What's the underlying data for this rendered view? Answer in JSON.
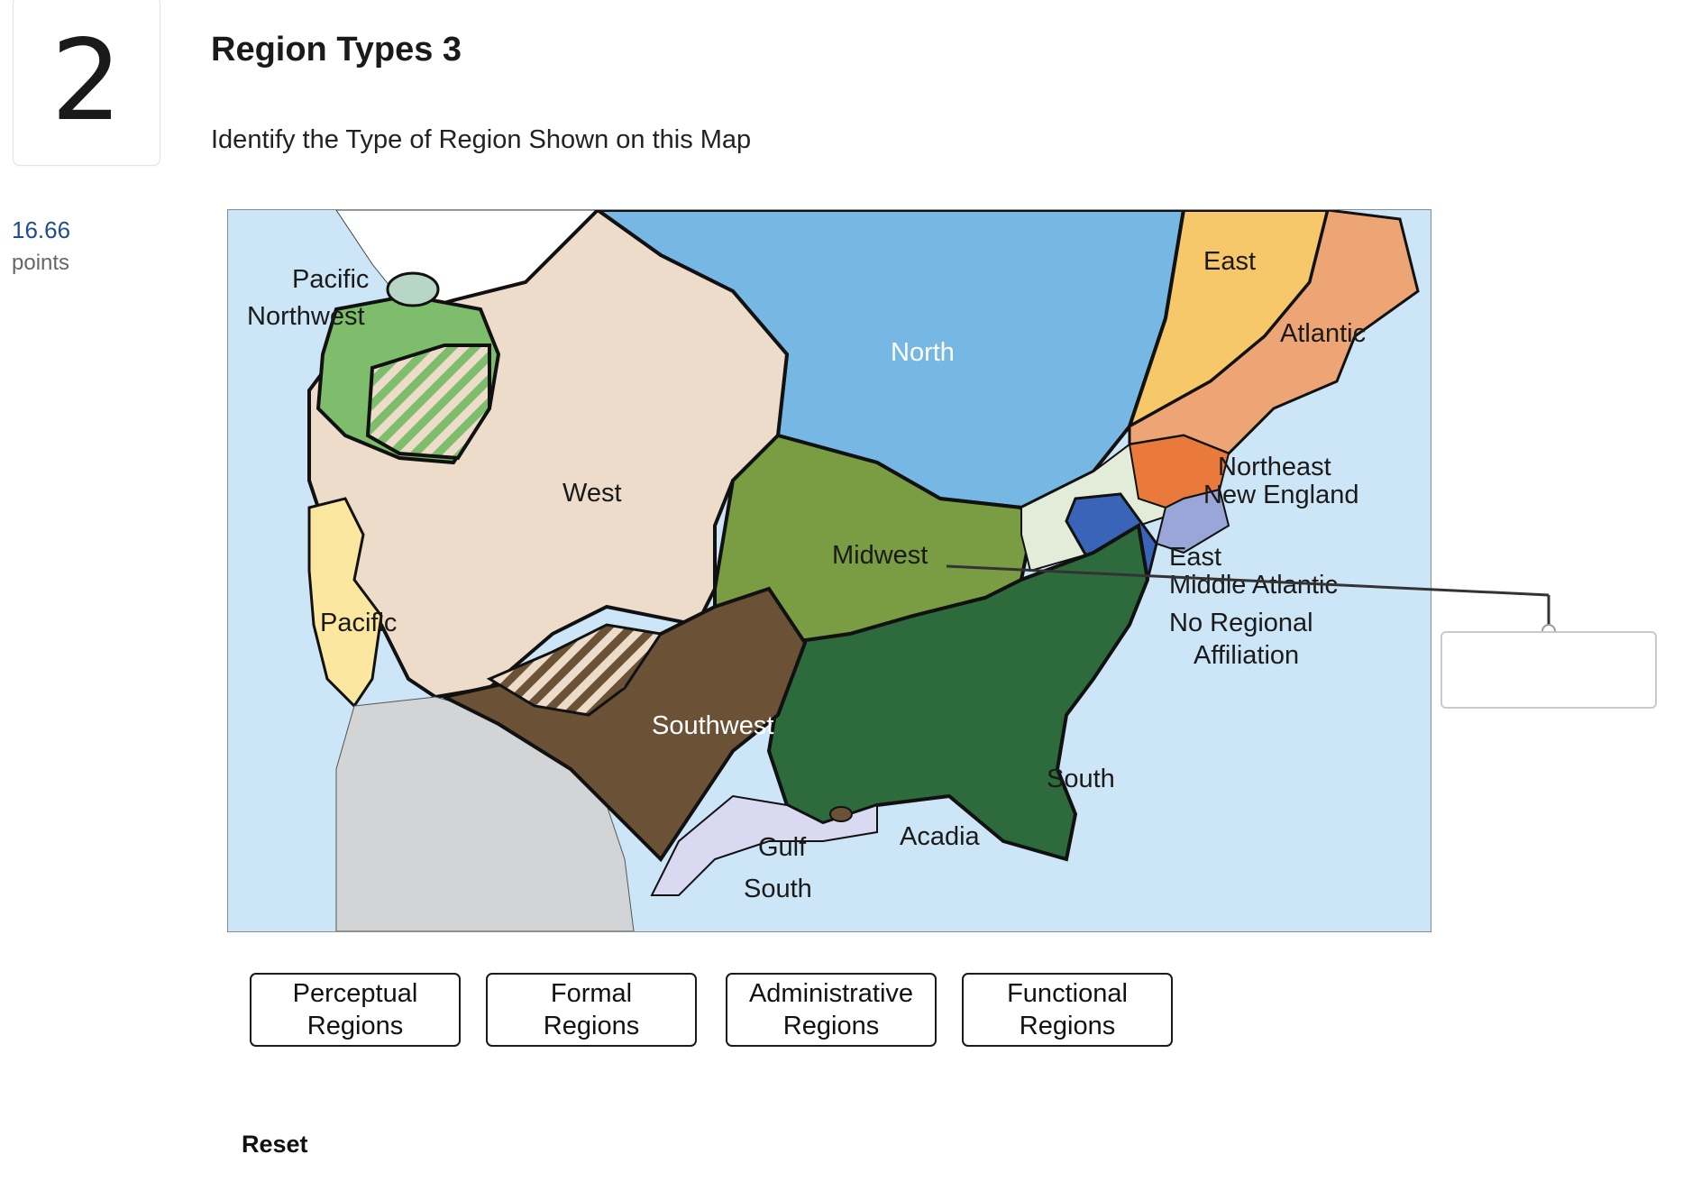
{
  "question": {
    "number": "2",
    "points_value": "16.66",
    "points_label": "points",
    "title": "Region Types 3",
    "prompt": "Identify the Type of Region Shown on this Map"
  },
  "map": {
    "labels": {
      "pacific_nw_1": "Pacific",
      "pacific_nw_2": "Northwest",
      "pacific": "Pacific",
      "west": "West",
      "north": "North",
      "east": "East",
      "atlantic": "Atlantic",
      "northeast": "Northeast",
      "new_england": "New England",
      "east_ma_1": "East",
      "east_ma_2": "Middle Atlantic",
      "no_regional_1": "No Regional",
      "no_regional_2": "Affiliation",
      "midwest": "Midwest",
      "southwest": "Southwest",
      "south": "South",
      "acadia": "Acadia",
      "gulf_1": "Gulf",
      "gulf_2": "South"
    },
    "colors": {
      "ocean": "#cde6f7",
      "west": "#ecdcc9",
      "north": "#76b7e4",
      "east": "#f7c86a",
      "atlantic": "#eea576",
      "new_england": "#9aa6d8",
      "northeast": "#ea7a3c",
      "middle_atlantic": "#3a64b7",
      "no_affiliation": "#e3ecd9",
      "midwest": "#7a9c43",
      "south": "#2d6a3c",
      "southwest": "#6b5236",
      "pacific": "#fbe7a0",
      "pacific_nw": "#7dbd6c",
      "gulf": "#d9d9f1",
      "mexico": "#d3d4d6"
    }
  },
  "choices": [
    {
      "id": "perceptual",
      "label_1": "Perceptual",
      "label_2": "Regions"
    },
    {
      "id": "formal",
      "label_1": "Formal",
      "label_2": "Regions"
    },
    {
      "id": "administrative",
      "label_1": "Administrative",
      "label_2": "Regions"
    },
    {
      "id": "functional",
      "label_1": "Functional",
      "label_2": "Regions"
    }
  ],
  "reset_label": "Reset"
}
